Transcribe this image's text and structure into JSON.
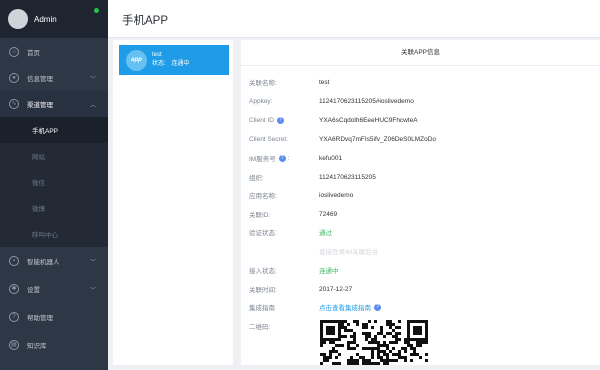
{
  "sidebar": {
    "user": "Admin",
    "items": [
      {
        "label": "首页",
        "icon": "home-icon"
      },
      {
        "label": "信息管理",
        "icon": "user-icon"
      },
      {
        "label": "渠道管理",
        "icon": "channel-icon"
      }
    ],
    "submenu": [
      "手机APP",
      "网站",
      "微信",
      "微博",
      "呼叫中心"
    ],
    "items_after": [
      {
        "label": "智能机器人",
        "icon": "robot-icon"
      },
      {
        "label": "设置",
        "icon": "gear-icon"
      },
      {
        "label": "帮助管理",
        "icon": "help-icon"
      },
      {
        "label": "知识库",
        "icon": "book-icon"
      }
    ]
  },
  "header": {
    "title": "手机APP"
  },
  "app_list": [
    {
      "logo": "app",
      "name": "test",
      "status_label": "状态:",
      "status_value": "连通中"
    }
  ],
  "info": {
    "title": "关联APP信息",
    "rows": [
      {
        "label": "关联名称:",
        "value": "test"
      },
      {
        "label": "Appkey:",
        "value": "1124170623115205#ioslivedemo"
      },
      {
        "label": "Client ID",
        "value": "YXA6sCqdolh6EeeHUC9FhcwteA",
        "help": true
      },
      {
        "label": "Client Secret:",
        "value": "YXA6RDvq7mFIs5ifv_Z06DeS0LMZoDo"
      },
      {
        "label": "IM服务号",
        "value": "kefu001",
        "help": true
      },
      {
        "label": "组织:",
        "value": "1124170623115205"
      },
      {
        "label": "应用名称:",
        "value": "ioslivedemo"
      },
      {
        "label": "关联ID:",
        "value": "72469"
      },
      {
        "label": "验证状态:",
        "value": "通过"
      },
      {
        "label": "",
        "value": "直接登录IM关联后台"
      },
      {
        "label": "接入状态:",
        "value": "连通中"
      },
      {
        "label": "关联时间:",
        "value": "2017-12-27"
      },
      {
        "label": "集成指南",
        "value": "点击查看集成指南"
      },
      {
        "label": "二维码:",
        "value": ""
      }
    ]
  },
  "colors": {
    "accent": "#1e9ce8",
    "success": "#3dbb62",
    "sidebar": "#2e3746"
  }
}
